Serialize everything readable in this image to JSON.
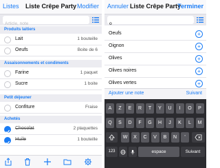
{
  "left": {
    "nav": {
      "back": "Listes",
      "title": "Liste Crêpe Party",
      "edit": "Modifier"
    },
    "search": {
      "placeholder": "Article, note"
    },
    "sections": [
      {
        "title": "Produits laitiers",
        "items": [
          {
            "name": "Lait",
            "qty": "1 bouteille",
            "checked": false
          },
          {
            "name": "Oeufs",
            "qty": "Boite de 6",
            "checked": false
          }
        ]
      },
      {
        "title": "Assaisonnements et condiments",
        "items": [
          {
            "name": "Farine",
            "qty": "1 paquet",
            "checked": false
          },
          {
            "name": "Sucre",
            "qty": "1 boite",
            "checked": false
          }
        ]
      },
      {
        "title": "Petit déjeuner",
        "items": [
          {
            "name": "Confiture",
            "qty": "Fraise",
            "checked": false
          }
        ]
      },
      {
        "title": "Achetés",
        "items": [
          {
            "name": "Chocolat",
            "qty": "2 plaquettes",
            "checked": true
          },
          {
            "name": "Huile",
            "qty": "1 bouteille",
            "checked": true
          }
        ]
      }
    ]
  },
  "right": {
    "nav": {
      "cancel": "Annuler",
      "title": "Liste Crêpe Party",
      "done": "Terminer"
    },
    "search": {
      "value": "o"
    },
    "suggestions": [
      "Oeufs",
      "Oignon",
      "Olives",
      "Olives noires",
      "Olives vertes"
    ],
    "add_note": "Ajouter une note",
    "next": "Suivant",
    "keyboard": {
      "row1": [
        "A",
        "Z",
        "E",
        "R",
        "T",
        "Y",
        "U",
        "I",
        "O",
        "P"
      ],
      "row2": [
        "Q",
        "S",
        "D",
        "F",
        "G",
        "H",
        "J",
        "K",
        "L",
        "M"
      ],
      "row3": [
        "W",
        "X",
        "C",
        "V",
        "B",
        "N",
        "'"
      ],
      "numbers": "123",
      "space": "espace",
      "next": "Suivant"
    }
  },
  "colors": {
    "accent": "#1a7cf5",
    "keyboard_bg": "#2b2b2f"
  }
}
